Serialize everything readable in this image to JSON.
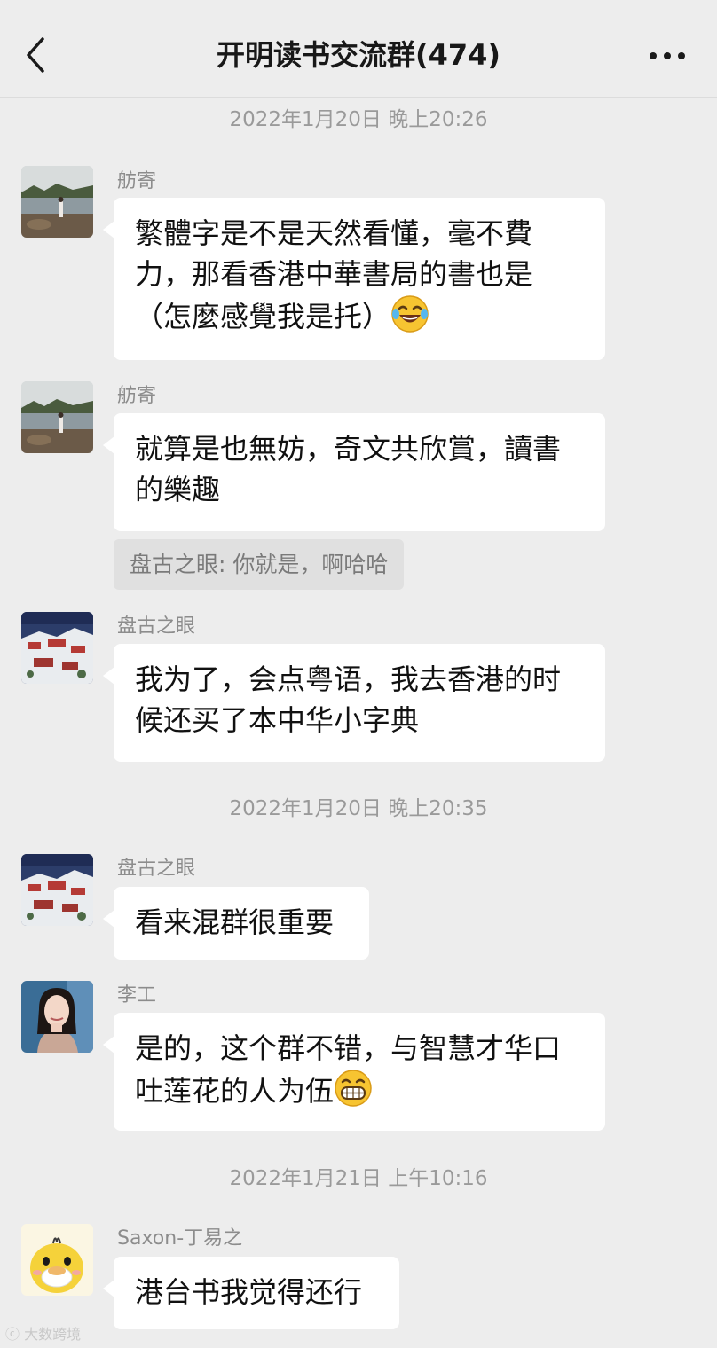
{
  "header": {
    "title": "开明读书交流群(474)",
    "back_icon": "chevron-left-icon",
    "more_icon": "more-dots-icon"
  },
  "timestamps": [
    "2022年1月20日 晚上20:26",
    "2022年1月20日 晚上20:35",
    "2022年1月21日 上午10:16"
  ],
  "messages": [
    {
      "sender": "舫寄",
      "avatar": "landscape-lake-avatar",
      "text_before_emoji": "繁體字是不是天然看懂，毫不費力，那看香港中華書局的書也是（怎麼感覺我是托）",
      "emoji": "laughing-tears-emoji"
    },
    {
      "sender": "舫寄",
      "avatar": "landscape-lake-avatar",
      "text": "就算是也無妨，奇文共欣賞，讀書的樂趣"
    },
    {
      "sender": "盘古之眼",
      "avatar": "snow-palace-avatar",
      "text": "我为了，会点粤语，我去香港的时候还买了本中华小字典"
    },
    {
      "sender": "盘古之眼",
      "avatar": "snow-palace-avatar",
      "text": "看来混群很重要"
    },
    {
      "sender": "李工",
      "avatar": "woman-portrait-avatar",
      "text_before_emoji": "是的，这个群不错，与智慧才华口吐莲花的人为伍",
      "emoji": "grinning-emoji"
    },
    {
      "sender": "Saxon-丁易之",
      "avatar": "yellow-duck-avatar",
      "text": "港台书我觉得还行"
    }
  ],
  "quote": {
    "text": "盘古之眼: 你就是，啊哈哈"
  },
  "watermark": "大数跨境",
  "colors": {
    "background": "#ededed",
    "bubble": "#ffffff",
    "quote_bg": "#e0e0e0",
    "meta_text": "#9a9a9a"
  }
}
